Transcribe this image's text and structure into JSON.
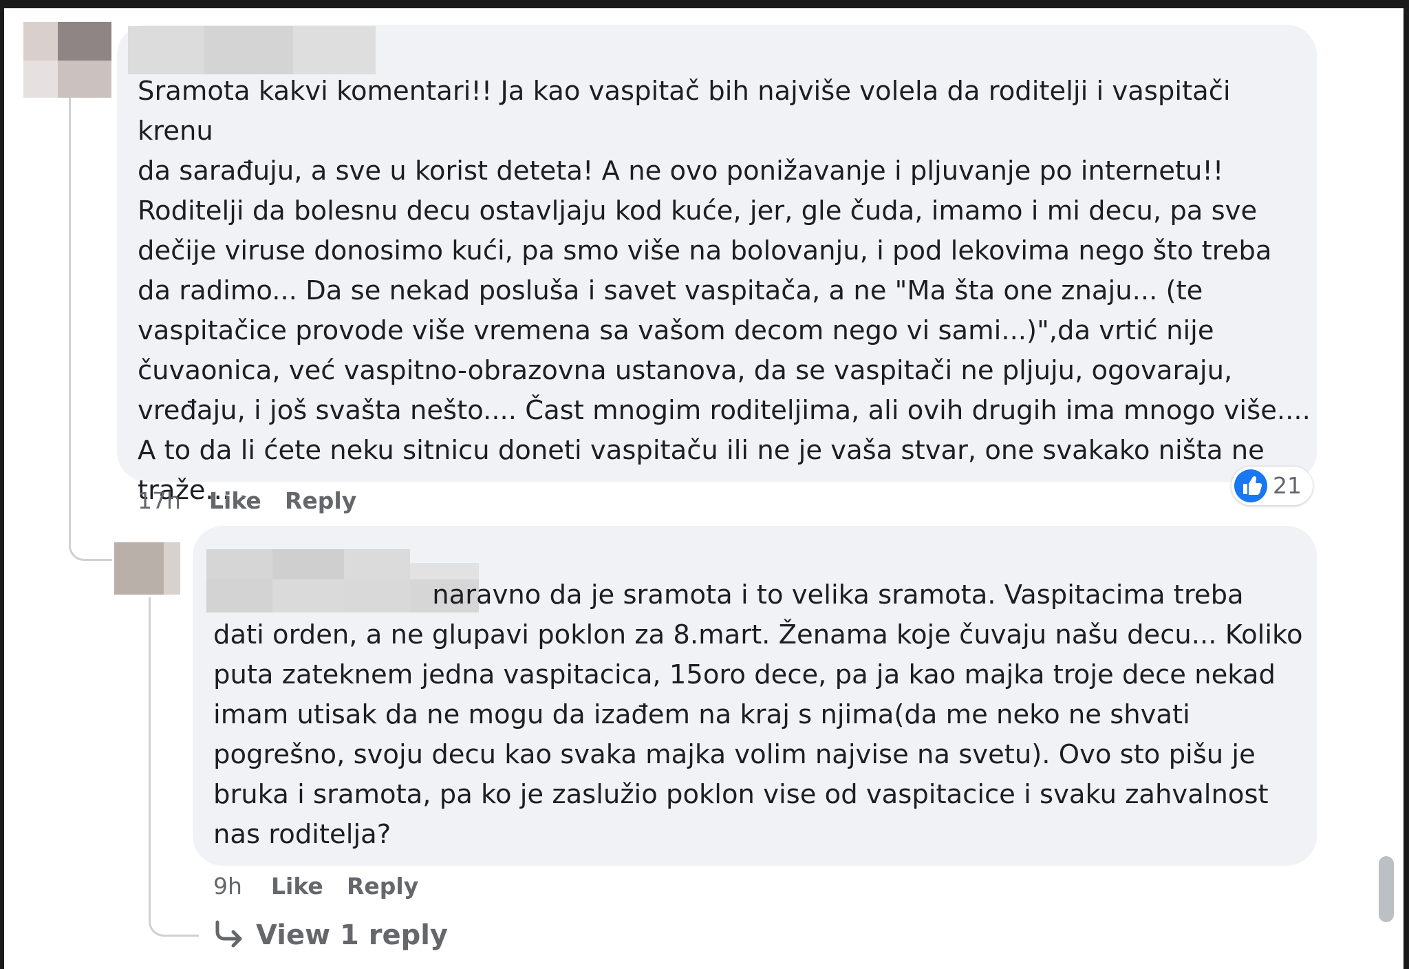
{
  "comments": [
    {
      "text": "Sramota kakvi komentari!! Ja kao vaspitač bih najviše volela da roditelji i vaspitači krenu\nda sarađuju, a sve u korist deteta! A ne ovo ponižavanje i pljuvanje po internetu!!\nRoditelji da bolesnu decu ostavljaju kod kuće, jer, gle čuda, imamo i mi decu, pa sve\ndečije viruse donosimo kući, pa smo više na bolovanju, i pod lekovima nego što treba\nda radimo... Da se nekad posluša i savet vaspitača, a ne \"Ma šta one znaju... (te\nvaspitačice provode više vremena sa vašom decom nego vi sami...)\",da vrtić nije\nčuvaonica, već vaspitno-obrazovna ustanova, da se vaspitači ne pljuju, ogovaraju,\nvređaju, i još svašta nešto.... Čast mnogim roditeljima, ali ovih drugih ima mnogo više....\nA to da li ćete neku sitnicu doneti vaspitaču ili ne je vaša stvar, one svakako ništa ne\ntraže.....",
      "time": "17h",
      "like_label": "Like",
      "reply_label": "Reply",
      "reaction_count": "21",
      "reaction_icon": "thumbs-up-icon",
      "reaction_color": "#1877f2"
    },
    {
      "text": "                          naravno da je sramota i to velika sramota. Vaspitacima treba\ndati orden, a ne glupavi poklon za 8.mart. Ženama koje čuvaju našu decu... Koliko\nputa zateknem jedna vaspitacica, 15oro dece, pa ja kao majka troje dece nekad\nimam utisak da ne mogu da izađem na kraj s njima(da me neko ne shvati\npogrešno, svoju decu kao svaka majka volim najvise na svetu). Ovo sto pišu je\nbruka i sramota, pa ko je zaslužio poklon vise od vaspitacice i svaku zahvalnost\nnas roditelja?",
      "time": "9h",
      "like_label": "Like",
      "reply_label": "Reply"
    }
  ],
  "view_replies": {
    "label": "View 1 reply",
    "icon": "reply-arrow-icon"
  },
  "colors": {
    "bubble": "#f0f2f5",
    "meta_text": "#65676b",
    "like_blue": "#1877f2"
  }
}
